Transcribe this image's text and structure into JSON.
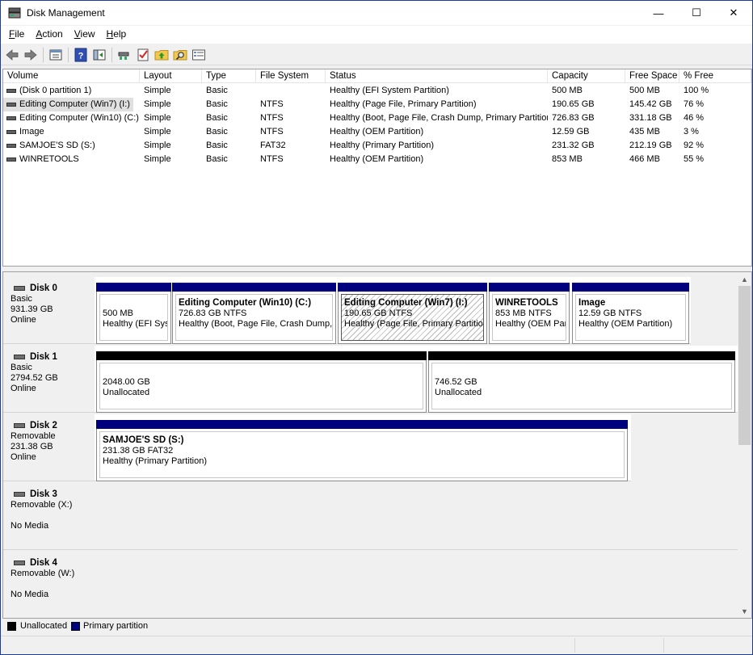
{
  "window": {
    "title": "Disk Management"
  },
  "titlebar_buttons": {
    "minimize": "—",
    "maximize": "☐",
    "close": "✕"
  },
  "menu": [
    "File",
    "Action",
    "View",
    "Help"
  ],
  "toolbar": [
    "back-icon",
    "forward-icon",
    "properties-icon",
    "help-icon",
    "show-pane-icon",
    "connect-icon",
    "check-icon",
    "folder-up-icon",
    "search-folder-icon",
    "list-view-icon"
  ],
  "volume_list": {
    "columns": [
      "Volume",
      "Layout",
      "Type",
      "File System",
      "Status",
      "Capacity",
      "Free Space",
      "% Free"
    ],
    "rows": [
      [
        "(Disk 0 partition 1)",
        "Simple",
        "Basic",
        "",
        "Healthy (EFI System Partition)",
        "500 MB",
        "500 MB",
        "100 %"
      ],
      [
        "Editing Computer (Win7) (I:)",
        "Simple",
        "Basic",
        "NTFS",
        "Healthy (Page File, Primary Partition)",
        "190.65 GB",
        "145.42 GB",
        "76 %"
      ],
      [
        "Editing Computer (Win10) (C:)",
        "Simple",
        "Basic",
        "NTFS",
        "Healthy (Boot, Page File, Crash Dump, Primary Partition)",
        "726.83 GB",
        "331.18 GB",
        "46 %"
      ],
      [
        "Image",
        "Simple",
        "Basic",
        "NTFS",
        "Healthy (OEM Partition)",
        "12.59 GB",
        "435 MB",
        "3 %"
      ],
      [
        "SAMJOE'S SD (S:)",
        "Simple",
        "Basic",
        "FAT32",
        "Healthy (Primary Partition)",
        "231.32 GB",
        "212.19 GB",
        "92 %"
      ],
      [
        "WINRETOOLS",
        "Simple",
        "Basic",
        "NTFS",
        "Healthy (OEM Partition)",
        "853 MB",
        "466 MB",
        "55 %"
      ]
    ],
    "selected_row": 1
  },
  "disks": [
    {
      "name": "Disk 0",
      "type": "Basic",
      "size": "931.39 GB",
      "status": "Online",
      "partitions": [
        {
          "kind": "primary",
          "name": "",
          "line1": "500 MB",
          "line2": "Healthy (EFI Sys"
        },
        {
          "kind": "primary",
          "name": "Editing Computer (Win10)  (C:)",
          "line1": "726.83 GB NTFS",
          "line2": "Healthy (Boot, Page File, Crash Dump, F"
        },
        {
          "kind": "primary",
          "name": "Editing Computer (Win7)  (I:)",
          "line1": "190.65 GB NTFS",
          "line2": "Healthy (Page File, Primary Partition)",
          "selected": true
        },
        {
          "kind": "primary",
          "name": "WINRETOOLS",
          "line1": "853 MB NTFS",
          "line2": "Healthy (OEM Parl"
        },
        {
          "kind": "primary",
          "name": "Image",
          "line1": "12.59 GB NTFS",
          "line2": "Healthy (OEM Partition)"
        }
      ]
    },
    {
      "name": "Disk 1",
      "type": "Basic",
      "size": "2794.52 GB",
      "status": "Online",
      "partitions": [
        {
          "kind": "unalloc",
          "name": "",
          "line1": "2048.00 GB",
          "line2": "Unallocated"
        },
        {
          "kind": "unalloc",
          "name": "",
          "line1": "746.52 GB",
          "line2": "Unallocated"
        }
      ]
    },
    {
      "name": "Disk 2",
      "type": "Removable",
      "size": "231.38 GB",
      "status": "Online",
      "partitions": [
        {
          "kind": "primary",
          "name": "SAMJOE'S SD  (S:)",
          "line1": "231.38 GB FAT32",
          "line2": "Healthy (Primary Partition)"
        }
      ]
    },
    {
      "name": "Disk 3",
      "type": "Removable (X:)",
      "size": "",
      "status": "No Media",
      "partitions": []
    },
    {
      "name": "Disk 4",
      "type": "Removable (W:)",
      "size": "",
      "status": "No Media",
      "partitions": []
    }
  ],
  "legend": [
    {
      "label": "Unallocated",
      "color": "#000000"
    },
    {
      "label": "Primary partition",
      "color": "#00007e"
    }
  ],
  "scroll_arrows": {
    "up": "▲",
    "down": "▼"
  }
}
